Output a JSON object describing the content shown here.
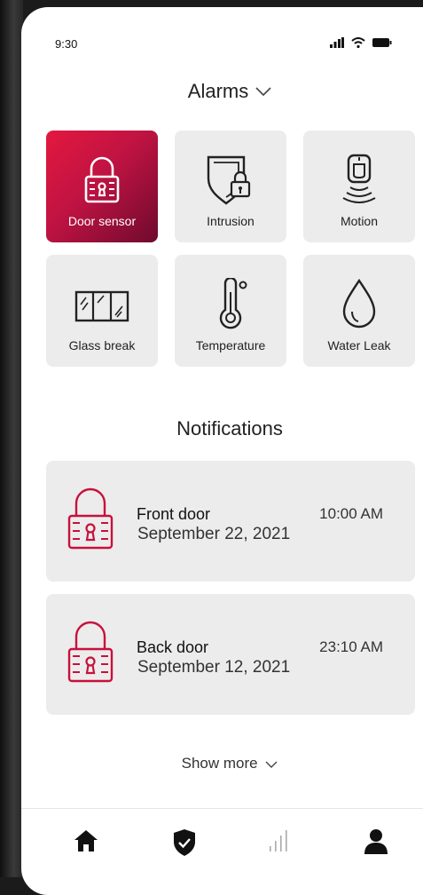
{
  "status_bar": {
    "time": "9:30"
  },
  "alarms": {
    "title": "Alarms",
    "tiles": [
      {
        "label": "Door sensor",
        "icon": "padlock-icon",
        "active": true
      },
      {
        "label": "Intrusion",
        "icon": "shield-lock-icon",
        "active": false
      },
      {
        "label": "Motion",
        "icon": "motion-sensor-icon",
        "active": false
      },
      {
        "label": "Glass break",
        "icon": "window-glass-icon",
        "active": false
      },
      {
        "label": "Temperature",
        "icon": "thermometer-icon",
        "active": false
      },
      {
        "label": "Water Leak",
        "icon": "water-drop-icon",
        "active": false
      }
    ]
  },
  "notifications": {
    "title": "Notifications",
    "items": [
      {
        "name": "Front door",
        "date": "September 22, 2021",
        "time": "10:00 AM",
        "icon": "padlock-icon"
      },
      {
        "name": "Back door",
        "date": "September 12, 2021",
        "time": "23:10 AM",
        "icon": "padlock-icon"
      }
    ],
    "show_more": "Show more"
  },
  "colors": {
    "accent": "#d7143c",
    "accent_dark": "#6e0a2e",
    "tile_bg": "#ececec"
  },
  "bottom_nav": {
    "items": [
      {
        "icon": "home-icon"
      },
      {
        "icon": "shield-check-icon"
      },
      {
        "icon": "signal-bars-icon"
      },
      {
        "icon": "user-icon"
      }
    ]
  }
}
